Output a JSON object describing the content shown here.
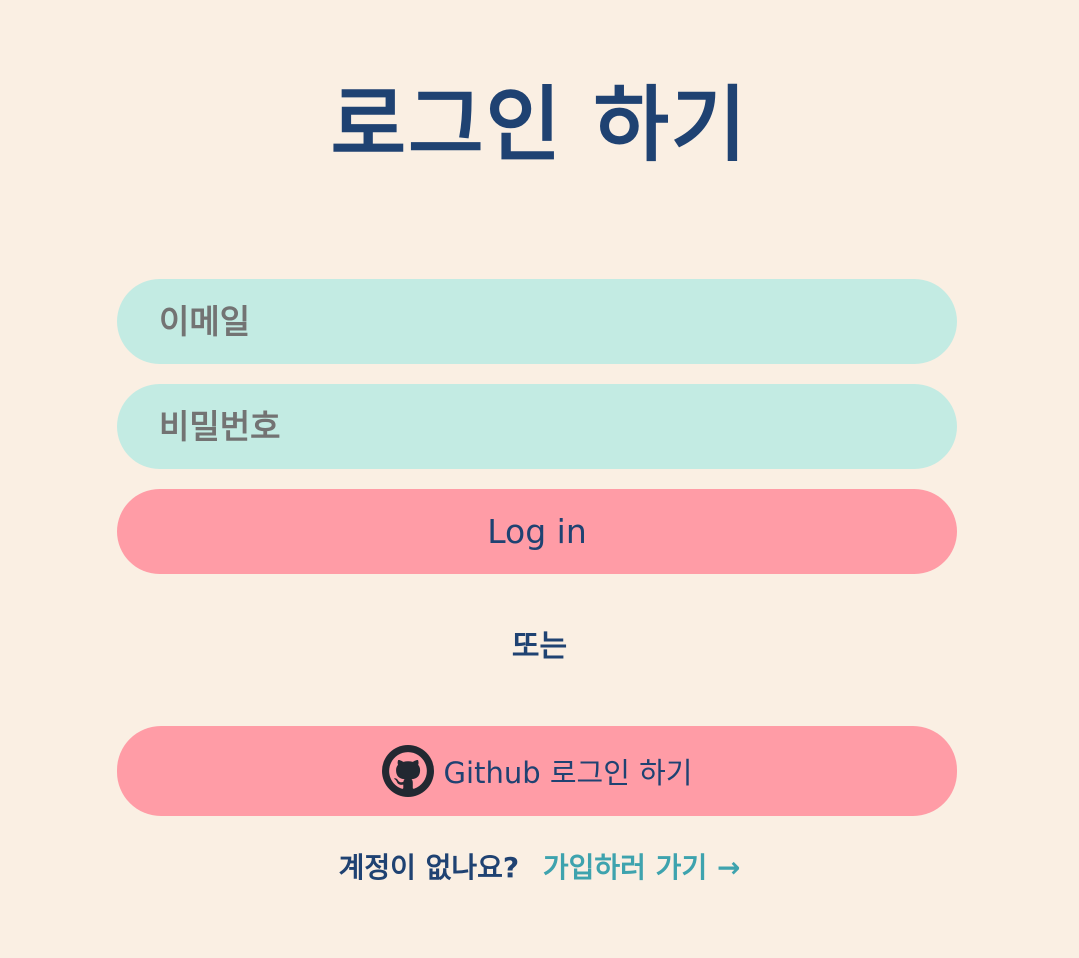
{
  "title": "로그인 하기",
  "form": {
    "email_placeholder": "이메일",
    "password_placeholder": "비밀번호",
    "login_label": "Log in"
  },
  "divider": "또는",
  "github": {
    "icon": "github-icon",
    "label": "Github 로그인 하기"
  },
  "signup": {
    "prompt": "계정이 없나요?",
    "link_label": "가입하러 가기 →"
  },
  "colors": {
    "background": "#faefe3",
    "primary_text": "#1f4272",
    "input_bg": "#c3ebe3",
    "button_bg": "#ff9ca6",
    "link": "#3ea3ae"
  }
}
